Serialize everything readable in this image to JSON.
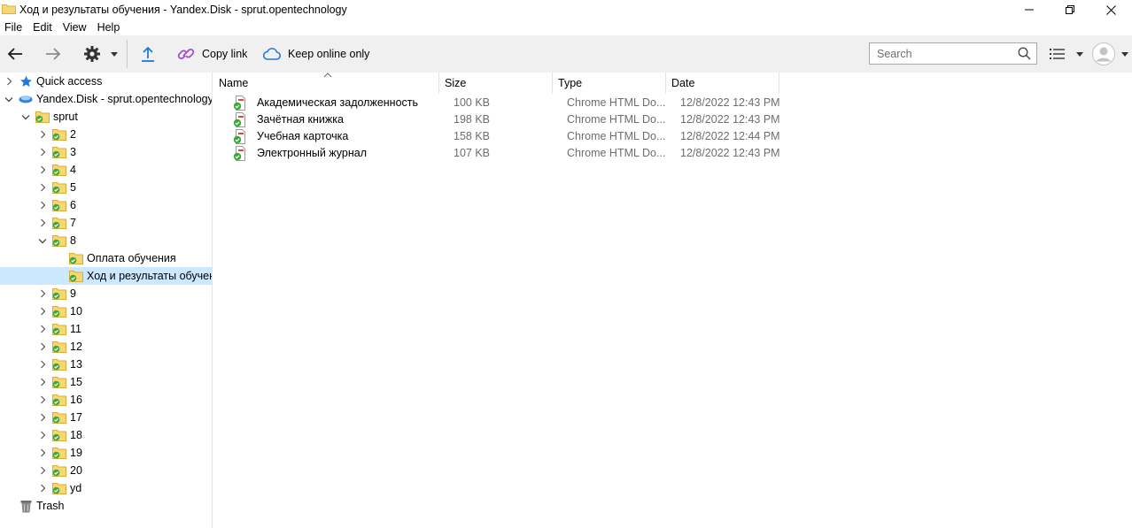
{
  "window": {
    "title": "Ход и результаты обучения - Yandex.Disk - sprut.opentechnology"
  },
  "menu": [
    "File",
    "Edit",
    "View",
    "Help"
  ],
  "toolbar": {
    "copy_link": "Copy link",
    "keep_online": "Keep online only",
    "search_placeholder": "Search"
  },
  "nav": {
    "quick_access": "Quick access",
    "yandex_disk": "Yandex.Disk - sprut.opentechnology",
    "sprut": "sprut",
    "folders_before": [
      "2",
      "3",
      "4",
      "5",
      "6",
      "7"
    ],
    "folder_open": "8",
    "subfolders": [
      "Оплата обучения",
      "Ход и результаты обучения"
    ],
    "folders_after": [
      "9",
      "10",
      "11",
      "12",
      "13",
      "15",
      "16",
      "17",
      "18",
      "19",
      "20",
      "yd"
    ],
    "trash": "Trash"
  },
  "columns": {
    "name": "Name",
    "size": "Size",
    "type": "Type",
    "date": "Date"
  },
  "files": [
    {
      "name": "Академическая задолженность",
      "size": "100 KB",
      "type": "Chrome HTML Do...",
      "date": "12/8/2022 12:43 PM"
    },
    {
      "name": "Зачётная книжка",
      "size": "198 KB",
      "type": "Chrome HTML Do...",
      "date": "12/8/2022 12:43 PM"
    },
    {
      "name": "Учебная карточка",
      "size": "158 KB",
      "type": "Chrome HTML Do...",
      "date": "12/8/2022 12:44 PM"
    },
    {
      "name": "Электронный журнал",
      "size": "107 KB",
      "type": "Chrome HTML Do...",
      "date": "12/8/2022 12:43 PM"
    }
  ],
  "colors": {
    "toolbar_bg": "#f0f0f0",
    "selection": "#cce8ff",
    "folder": "#f7d774",
    "sync_ok": "#3aa935"
  }
}
